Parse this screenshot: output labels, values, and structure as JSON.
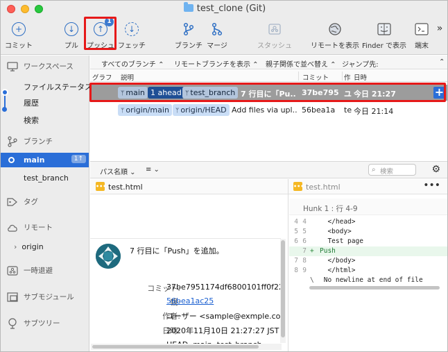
{
  "window": {
    "title": "test_clone (Git)"
  },
  "toolbar": {
    "commit": "コミット",
    "pull": "プル",
    "push": "プッシュ",
    "push_badge": "1",
    "fetch": "フェッチ",
    "branch": "ブランチ",
    "merge": "マージ",
    "stash": "スタッシュ",
    "show_remote": "リモートを表示",
    "finder": "Finder で表示",
    "terminal": "端末",
    "more": "»"
  },
  "sidebar": {
    "workspace": "ワークスペース",
    "file_status": "ファイルステータス",
    "history": "履歴",
    "search": "検索",
    "branches": "ブランチ",
    "current_branch": "main",
    "current_branch_count": "1↑",
    "other_branch": "test_branch",
    "tags": "タグ",
    "remotes": "リモート",
    "remote_origin": "origin",
    "stashes": "一時退避",
    "submodules": "サブモジュール",
    "subtrees": "サブツリー"
  },
  "filterbar": {
    "all_branches": "すべてのブランチ ⌃",
    "show_remote_branches": "リモートブランチを表示 ⌃",
    "sort_by_parent": "親子関係で並べ替え ⌃",
    "jump_to": "ジャンプ先:",
    "jump_chevron": "⌃"
  },
  "columns": {
    "graph": "グラフ",
    "description": "説明",
    "commit": "コミット",
    "author_short": "作",
    "date": "日時"
  },
  "commits": [
    {
      "refs": [
        "main",
        "1 ahead",
        "test_branch"
      ],
      "message": "7 行目に「Pu...",
      "hash": "37be795",
      "author_short": "ユ",
      "date": "今日 21:27"
    },
    {
      "refs": [
        "origin/main",
        "origin/HEAD"
      ],
      "message": "Add files via upl...",
      "hash": "56bea1a",
      "author_short": "te",
      "date": "今日 21:14"
    }
  ],
  "lower": {
    "path_sort": "パス名順 ⌄",
    "list_mode": "≡ ⌄",
    "search_placeholder": "検索"
  },
  "file_left": "test.html",
  "file_right": "test.html",
  "commit_detail": {
    "message": "7 行目に「Push」を追加。",
    "commit_label": "コミット:",
    "commit_value": "37be7951174df6800101ff0f229",
    "parent_label": "親:",
    "parent_value": "56bea1ac25",
    "author_label": "作者:",
    "author_value": "ユーザー <sample@exmple.com>",
    "date_label": "日時:",
    "date_value": "2020年11月10日 21:27:27 JST",
    "cut_line": "HEAD, main, test_branch"
  },
  "diff": {
    "hunk": "Hunk 1 : 行 4-9",
    "lines": [
      {
        "old": "4",
        "new": "4",
        "sign": "",
        "text": "  </head>",
        "type": "ctx"
      },
      {
        "old": "5",
        "new": "5",
        "sign": "",
        "text": "  <body>",
        "type": "ctx"
      },
      {
        "old": "6",
        "new": "6",
        "sign": "",
        "text": "  Test page",
        "type": "ctx"
      },
      {
        "old": "",
        "new": "7",
        "sign": "+",
        "text": "Push",
        "type": "add"
      },
      {
        "old": "7",
        "new": "8",
        "sign": "",
        "text": "  </body>",
        "type": "ctx"
      },
      {
        "old": "8",
        "new": "9",
        "sign": "",
        "text": "  </html>",
        "type": "ctx"
      },
      {
        "old": "",
        "new": "",
        "sign": "\\",
        "text": " No newline at end of file",
        "type": "ctx"
      }
    ]
  },
  "colors": {
    "accent": "#2a6ed8",
    "highlight": "#e61919",
    "selected_row": "#9c9c9c"
  }
}
